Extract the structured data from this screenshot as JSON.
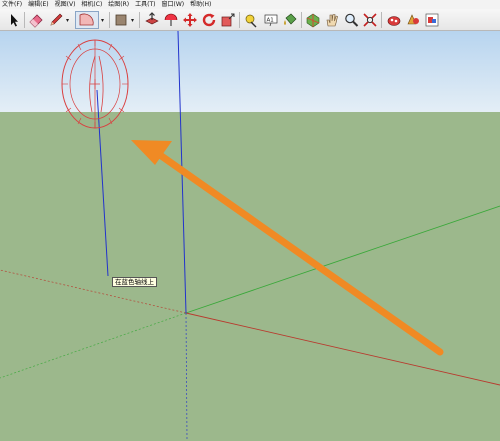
{
  "menu": {
    "file": "文件(F)",
    "edit": "编辑(E)",
    "view": "视图(V)",
    "camera": "相机(C)",
    "draw": "绘图(R)",
    "tools": "工具(T)",
    "window": "窗口(W)",
    "help": "帮助(H)"
  },
  "toolbar": {
    "dropdown_glyph": "▾",
    "text_tool_glyph": "A1",
    "tools": [
      "select",
      "eraser",
      "pencil",
      "protractor",
      "rectangle",
      "push-pull",
      "orbit",
      "move",
      "rotate",
      "scale",
      "tape-measure",
      "text",
      "paint-bucket",
      "pan",
      "walk",
      "zoom",
      "zoom-extents",
      "components",
      "materials",
      "styles"
    ]
  },
  "viewport": {
    "tooltip": "在蓝色轴线上",
    "sky_color": "#cfe3f5",
    "ground_color": "#9cb88c",
    "red_axis": "#c0392b",
    "green_axis": "#3aa83a",
    "blue_axis": "#2233cc",
    "arrow_color": "#f08a24"
  }
}
